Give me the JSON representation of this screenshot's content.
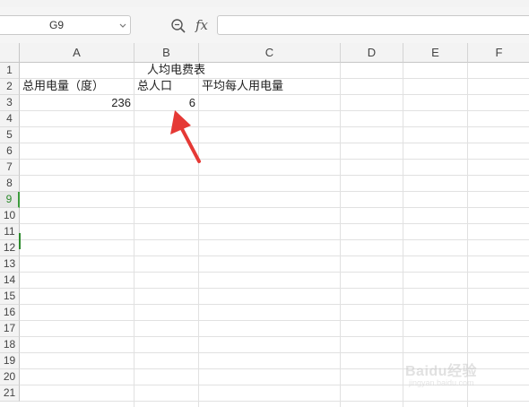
{
  "formula_bar": {
    "name_box": "G9",
    "fx_label": "fx",
    "formula_value": ""
  },
  "columns": [
    "A",
    "B",
    "C",
    "D",
    "E",
    "F"
  ],
  "rows": [
    "1",
    "2",
    "3",
    "4",
    "5",
    "6",
    "7",
    "8",
    "9",
    "10",
    "11",
    "12",
    "13",
    "14",
    "15",
    "16",
    "17",
    "18",
    "19",
    "20",
    "21"
  ],
  "active_row": "9",
  "cells": {
    "title": "人均电费表",
    "a2": "总用电量（度）",
    "b2": "总人口",
    "c2": "平均每人用电量",
    "a3": "236",
    "b3": "6"
  },
  "icons": {
    "zoom": "zoom-icon",
    "dropdown": "chevron-down-icon",
    "annotation": "red-arrow-annotation",
    "watermark": "baidu-watermark"
  },
  "watermark": {
    "brand": "Baidu经验",
    "sub": "jingyan.baidu.com"
  },
  "colors": {
    "annotation_arrow": "#e53935",
    "active_row_accent": "#2e8b2e"
  }
}
